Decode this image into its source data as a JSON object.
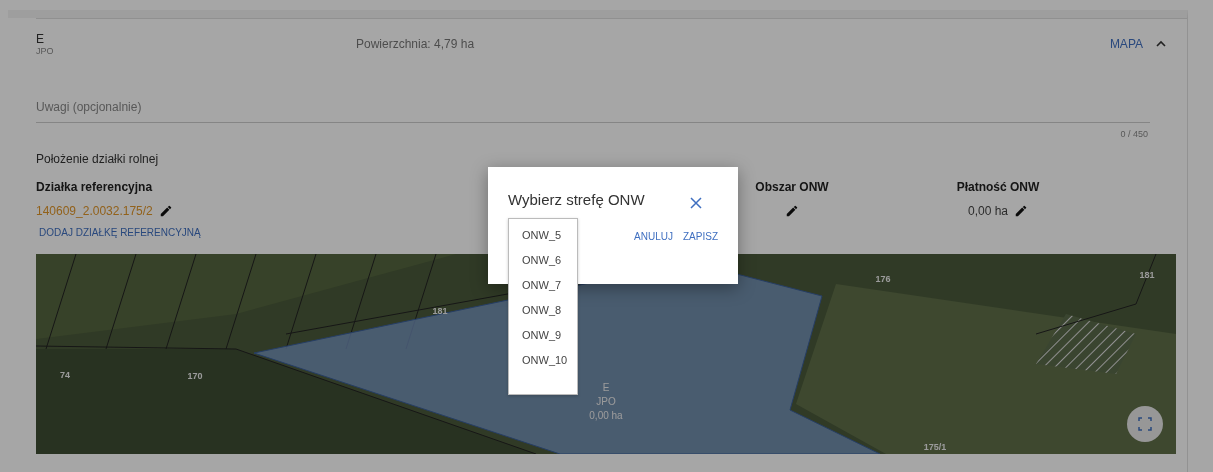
{
  "panel": {
    "name": "E",
    "subname": "JPO",
    "area": "Powierzchnia: 4,79 ha",
    "map_link": "MAPA",
    "expanded": true
  },
  "remarks": {
    "placeholder": "Uwagi (opcjonalnie)",
    "counter": "0 / 450"
  },
  "location_heading": "Położenie działki rolnej",
  "columns": [
    {
      "heading": "Działka referencyjna",
      "value": "140609_2.0032.175/2",
      "kind": "link"
    },
    {
      "heading": "Obszar ONW",
      "kind": "centered"
    },
    {
      "heading": "Płatność ONW",
      "value": "0,00 ha",
      "kind": "centered"
    }
  ],
  "add_link": "DODAJ DZIAŁKĘ REFERENCYJNĄ",
  "map": {
    "labels": [
      "181",
      "176",
      "181",
      "74",
      "170",
      "175/1"
    ],
    "parcel": {
      "name": "E",
      "subname": "JPO",
      "area": "0,00 ha"
    }
  },
  "dialog": {
    "title": "Wybierz strefę ONW",
    "options": [
      "ONW_5",
      "ONW_6",
      "ONW_7",
      "ONW_8",
      "ONW_9",
      "ONW_10"
    ],
    "buttons": [
      "ANULUJ",
      "ZAPISZ"
    ]
  }
}
